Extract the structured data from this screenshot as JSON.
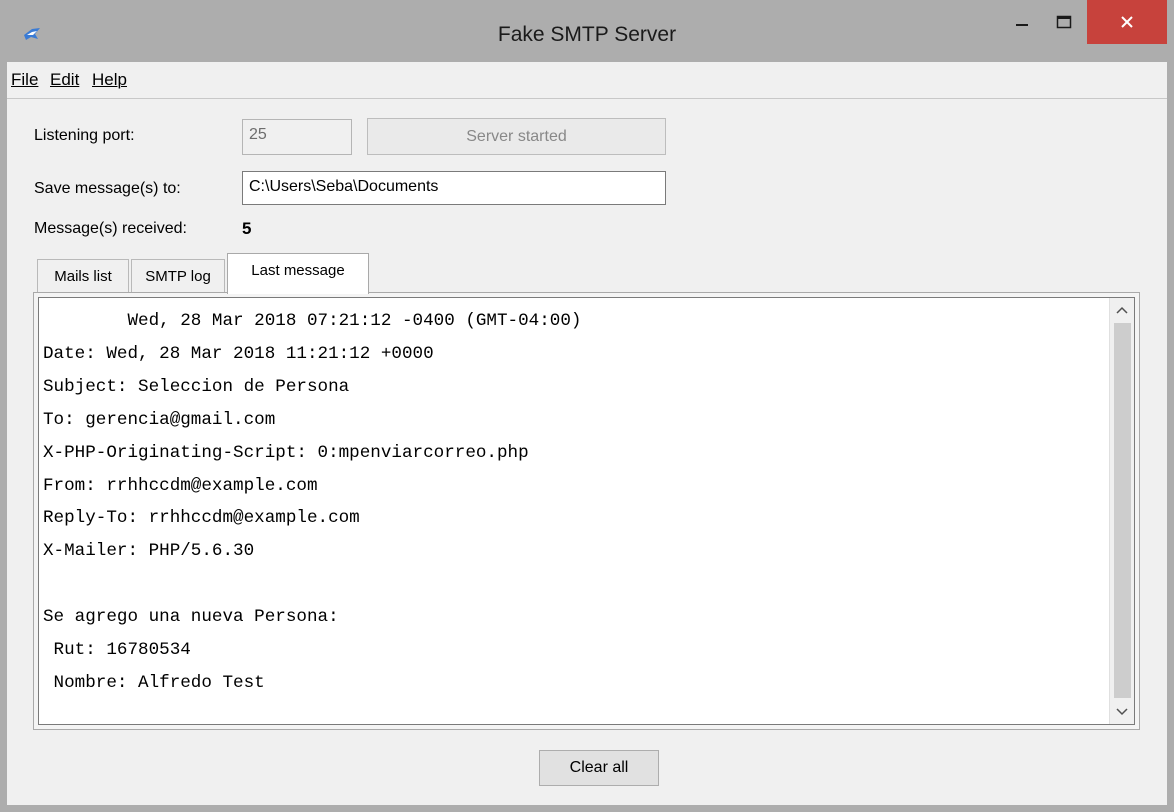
{
  "window": {
    "title": "Fake SMTP Server",
    "icon": "envelope-bird-icon",
    "controls": [
      "minimize-icon",
      "maximize-icon",
      "close-icon"
    ],
    "close_color": "#c7423c"
  },
  "menu": {
    "file": "File",
    "edit": "Edit",
    "help": "Help"
  },
  "settings": {
    "port_label": "Listening port:",
    "port_value": "25",
    "server_button": "Server started",
    "save_label": "Save message(s) to:",
    "save_path": "C:\\Users\\Seba\\Documents",
    "received_label": "Message(s) received:",
    "received_count": "5"
  },
  "tabs": [
    {
      "label": "Mails list",
      "active": false
    },
    {
      "label": "SMTP log",
      "active": false
    },
    {
      "label": "Last message",
      "active": true
    }
  ],
  "last_message": {
    "text": "        Wed, 28 Mar 2018 07:21:12 -0400 (GMT-04:00)\nDate: Wed, 28 Mar 2018 11:21:12 +0000\nSubject: Seleccion de Persona\nTo: gerencia@gmail.com\nX-PHP-Originating-Script: 0:mpenviarcorreo.php\nFrom: rrhhccdm@example.com\nReply-To: rrhhccdm@example.com\nX-Mailer: PHP/5.6.30\n\nSe agrego una nueva Persona:\n Rut: 16780534\n Nombre: Alfredo Test"
  },
  "footer": {
    "clear_button": "Clear all"
  }
}
